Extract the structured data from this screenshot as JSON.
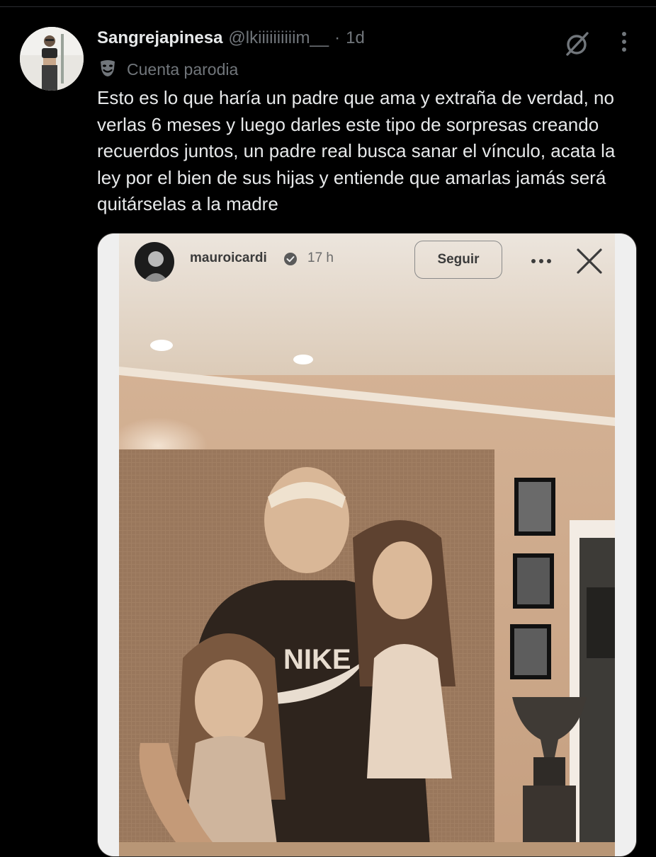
{
  "tweet": {
    "display_name": "Sangrejapinesa",
    "handle": "@lkiiiiiiiiiim__",
    "separator": "·",
    "time": "1d",
    "badge_label": "Cuenta parodia",
    "text": "Esto es lo que haría un padre que ama y extraña de verdad, no verlas 6 meses y luego darles este tipo de sorpresas creando recuerdos juntos, un padre real busca sanar el vínculo, acata la ley por el bien de sus hijas y entiende que amarlas jamás será quitárselas a la madre"
  },
  "story": {
    "username": "mauroicardi",
    "time": "17 h",
    "follow_label": "Seguir",
    "shirt_text": "NIKE"
  },
  "icons": {
    "grok": "grok-icon",
    "more": "more-vertical-icon",
    "parody": "theater-mask-icon",
    "verified": "verified-badge-icon",
    "story_more": "more-horizontal-icon",
    "close": "close-icon"
  },
  "colors": {
    "background": "#000000",
    "primary_text": "#e7e9ea",
    "secondary_text": "#71767b",
    "sepia": "#c9a98e"
  }
}
